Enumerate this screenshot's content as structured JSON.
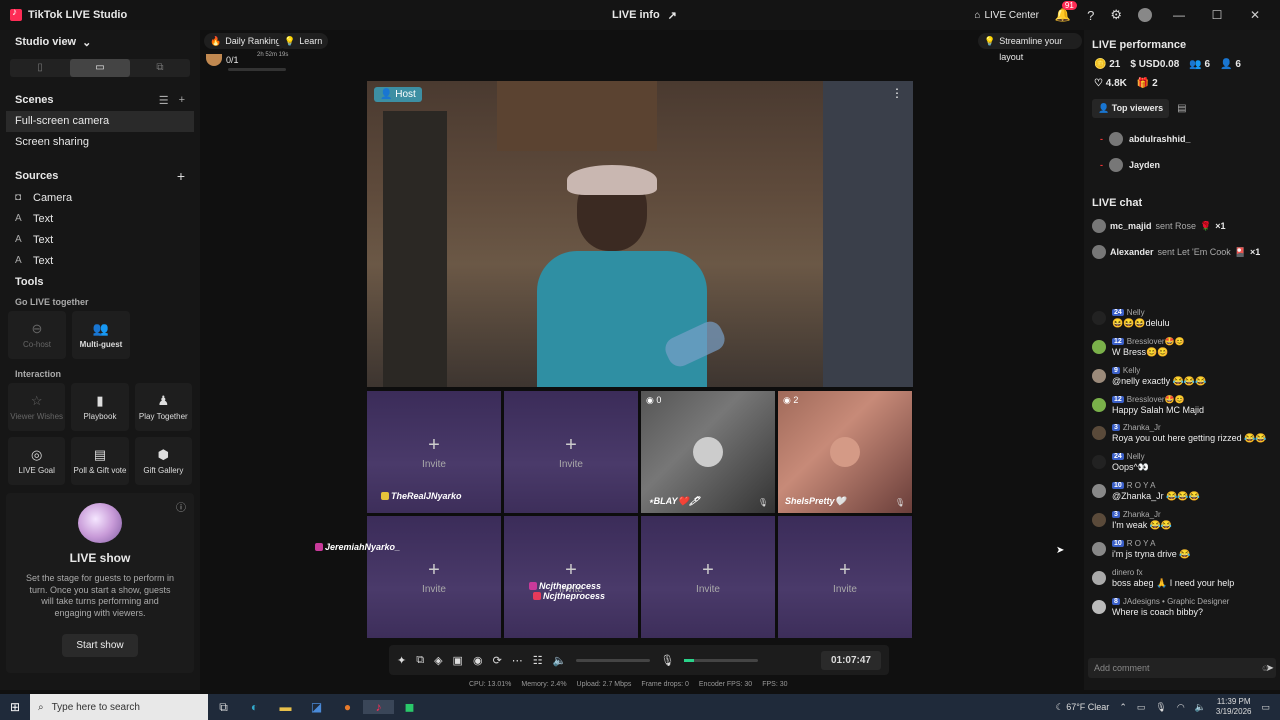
{
  "titlebar": {
    "app_title": "TikTok LIVE Studio",
    "live_info": "LIVE info",
    "live_center": "LIVE Center",
    "notif_count": "91"
  },
  "left": {
    "studio_view": "Studio view",
    "scenes_title": "Scenes",
    "scenes": [
      "Full-screen camera",
      "Screen sharing"
    ],
    "sources_title": "Sources",
    "sources": [
      {
        "icon": "camera-icon",
        "label": "Camera"
      },
      {
        "icon": "text-icon",
        "label": "Text"
      },
      {
        "icon": "text-icon",
        "label": "Text"
      },
      {
        "icon": "text-icon",
        "label": "Text"
      }
    ],
    "tools_title": "Tools",
    "go_live_title": "Go LIVE together",
    "cohost": "Co-host",
    "multiguest": "Multi-guest",
    "interaction_title": "Interaction",
    "viewer_wishes": "Viewer Wishes",
    "playbook": "Playbook",
    "play_together": "Play Together",
    "live_goal": "LIVE Goal",
    "poll_vote": "Poll & Gift vote",
    "gift_gallery": "Gift Gallery",
    "liveshow_title": "LIVE show",
    "liveshow_desc": "Set the stage for guests to perform in turn. Once you start a show, guests will take turns performing and engaging with viewers.",
    "start_show": "Start show"
  },
  "center": {
    "daily_ranking": "Daily Ranking",
    "learn": "Learn",
    "rank_value": "0/1",
    "rank_timer": "2h 52m 19s",
    "streamline": "Streamline your layout",
    "host_label": "Host",
    "invite": "Invite",
    "guest1_count": "0",
    "guest1_name": "⋆BLAY❤️🖊",
    "guest2_count": "2",
    "guest2_name": "SheIsPretty🤍",
    "overlay_user1": "TheRealJNyarko",
    "overlay_user2": "JeremiahNyarko_",
    "overlay_user3": "Ncjtheprocess",
    "overlay_user4": "Ncjtheprocess",
    "timer": "01:07:47",
    "mic_level": 0.13,
    "stats": {
      "cpu": "CPU: 13.01%",
      "memory": "Memory: 2.4%",
      "upload": "Upload: 2.7 Mbps",
      "frame_drops": "Frame drops: 0",
      "encoder_fps": "Encoder FPS: 30",
      "fps": "FPS: 30"
    }
  },
  "right": {
    "perf_title": "LIVE performance",
    "perf": {
      "coins": "21",
      "usd": "USD0.08",
      "viewers": "6",
      "new_followers": "6",
      "likes": "4.8K",
      "gifts": "2"
    },
    "top_viewers": "Top viewers",
    "viewers": [
      "abdulrashhid_",
      "Jayden"
    ],
    "chat_title": "LIVE chat",
    "gifts": [
      {
        "user": "mc_majid",
        "action": "sent Rose",
        "count": "×1"
      },
      {
        "user": "Alexander",
        "action": "sent Let 'Em Cook",
        "count": "×1"
      }
    ],
    "messages": [
      {
        "level": "24",
        "name": "Nelly",
        "text": "😆😆😆delulu"
      },
      {
        "level": "12",
        "name": "Bresslover🤩😊",
        "text": "W Bress😊😊"
      },
      {
        "level": "9",
        "name": "Kelly",
        "text": "@nelly exactly 😂😂😂"
      },
      {
        "level": "12",
        "name": "Bresslover🤩😊",
        "text": "Happy Salah MC Majid"
      },
      {
        "level": "3",
        "name": "Zhanka_Jr",
        "text": "Roya you out here getting rizzed 😂😂"
      },
      {
        "level": "24",
        "name": "Nelly",
        "text": "Oops^👀"
      },
      {
        "level": "10",
        "name": "R O Y A",
        "text": "@Zhanka_Jr 😂😂😂"
      },
      {
        "level": "3",
        "name": "Zhanka_Jr",
        "text": "I'm weak 😂😂"
      },
      {
        "level": "10",
        "name": "R O Y A",
        "text": "i'm js tryna drive 😂"
      },
      {
        "level": "",
        "name": "dinero fx",
        "text": "boss abeg 🙏 I need your help"
      },
      {
        "level": "8",
        "name": "JAdesigns • Graphic Designer",
        "text": "Where is coach bibby?"
      }
    ],
    "add_comment": "Add comment"
  },
  "taskbar": {
    "search_placeholder": "Type here to search",
    "weather": "67°F  Clear",
    "time": "11:39 PM",
    "date": "3/19/2026"
  }
}
